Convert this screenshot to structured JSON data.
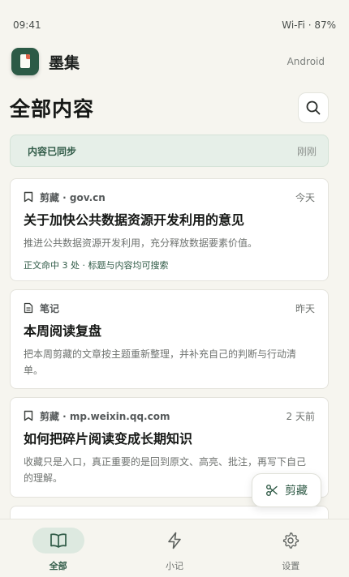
{
  "status_bar": {
    "time": "09:41",
    "right": "Wi‑Fi · 87%"
  },
  "app": {
    "name": "墨集",
    "platform": "Android"
  },
  "page": {
    "title": "全部内容"
  },
  "sync": {
    "text": "内容已同步",
    "time": "刚刚"
  },
  "cards": [
    {
      "type": "剪藏 · gov.cn",
      "time": "今天",
      "title": "关于加快公共数据资源开发利用的意见",
      "desc": "推进公共数据资源开发利用，充分释放数据要素价值。",
      "match": "正文命中 3 处 · 标题与内容均可搜索",
      "icon": "bookmark-icon"
    },
    {
      "type": "笔记",
      "time": "昨天",
      "title": "本周阅读复盘",
      "desc": "把本周剪藏的文章按主题重新整理，并补充自己的判断与行动清单。",
      "icon": "note-icon"
    },
    {
      "type": "剪藏 · mp.weixin.qq.com",
      "time": "2 天前",
      "title": "如何把碎片阅读变成长期知识",
      "desc": "收藏只是入口，真正重要的是回到原文、高亮、批注，再写下自己的理解。",
      "icon": "bookmark-icon"
    }
  ],
  "fab": {
    "label": "剪藏",
    "icon": "scissors-icon"
  },
  "nav": [
    {
      "label": "全部",
      "icon": "book-icon",
      "active": true
    },
    {
      "label": "小记",
      "icon": "lightning-icon",
      "active": false
    },
    {
      "label": "设置",
      "icon": "gear-icon",
      "active": false
    }
  ],
  "colors": {
    "accent": "#2f5a46",
    "background": "#f6f5ef",
    "logo_ribbon": "#e0634a"
  }
}
